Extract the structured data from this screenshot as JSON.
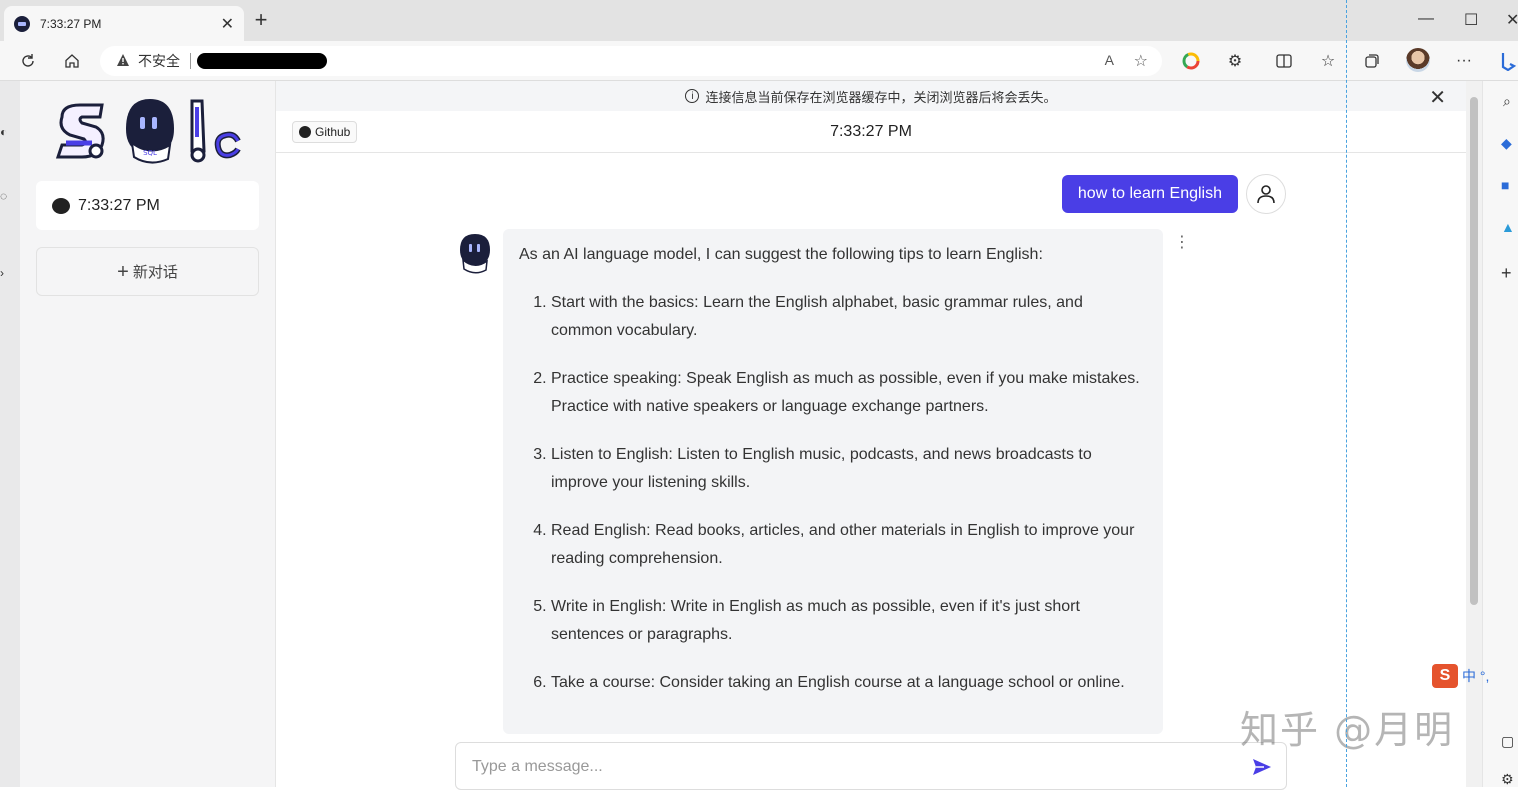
{
  "browser": {
    "tab_title": "7:33:27 PM",
    "tab_close": "✕",
    "new_tab": "+",
    "minimize": "—",
    "maximize": "☐",
    "close": "✕",
    "security_warning_icon": "warning-icon",
    "security_label": "不安全",
    "read_aloud": "A",
    "more": "···"
  },
  "sidebar": {
    "conversation_label": "7:33:27 PM",
    "new_chat_label": "新对话",
    "new_chat_icon": "+"
  },
  "notice": {
    "icon": "i",
    "text": "连接信息当前保存在浏览器缓存中，关闭浏览器后将会丢失。",
    "close": "✕"
  },
  "chat": {
    "github_label": "Github",
    "title": "7:33:27 PM",
    "user_message": "how to learn English",
    "bot_intro": "As an AI language model, I can suggest the following tips to learn English:",
    "bot_tips": [
      "Start with the basics: Learn the English alphabet, basic grammar rules, and common vocabulary.",
      "Practice speaking: Speak English as much as possible, even if you make mistakes. Practice with native speakers or language exchange partners.",
      "Listen to English: Listen to English music, podcasts, and news broadcasts to improve your listening skills.",
      "Read English: Read books, articles, and other materials in English to improve your reading comprehension.",
      "Write in English: Write in English as much as possible, even if it's just short sentences or paragraphs.",
      "Take a course: Consider taking an English course at a language school or online."
    ],
    "more_icon": "⋮",
    "input_placeholder": "Type a message..."
  },
  "overlay": {
    "ime_logo": "S",
    "ime_text": "中 °,",
    "watermark": "知乎 @月明"
  },
  "colors": {
    "accent": "#4a3ee6",
    "bot_bubble": "#f3f4f6",
    "sidebar_bg": "#f5f5f6"
  }
}
